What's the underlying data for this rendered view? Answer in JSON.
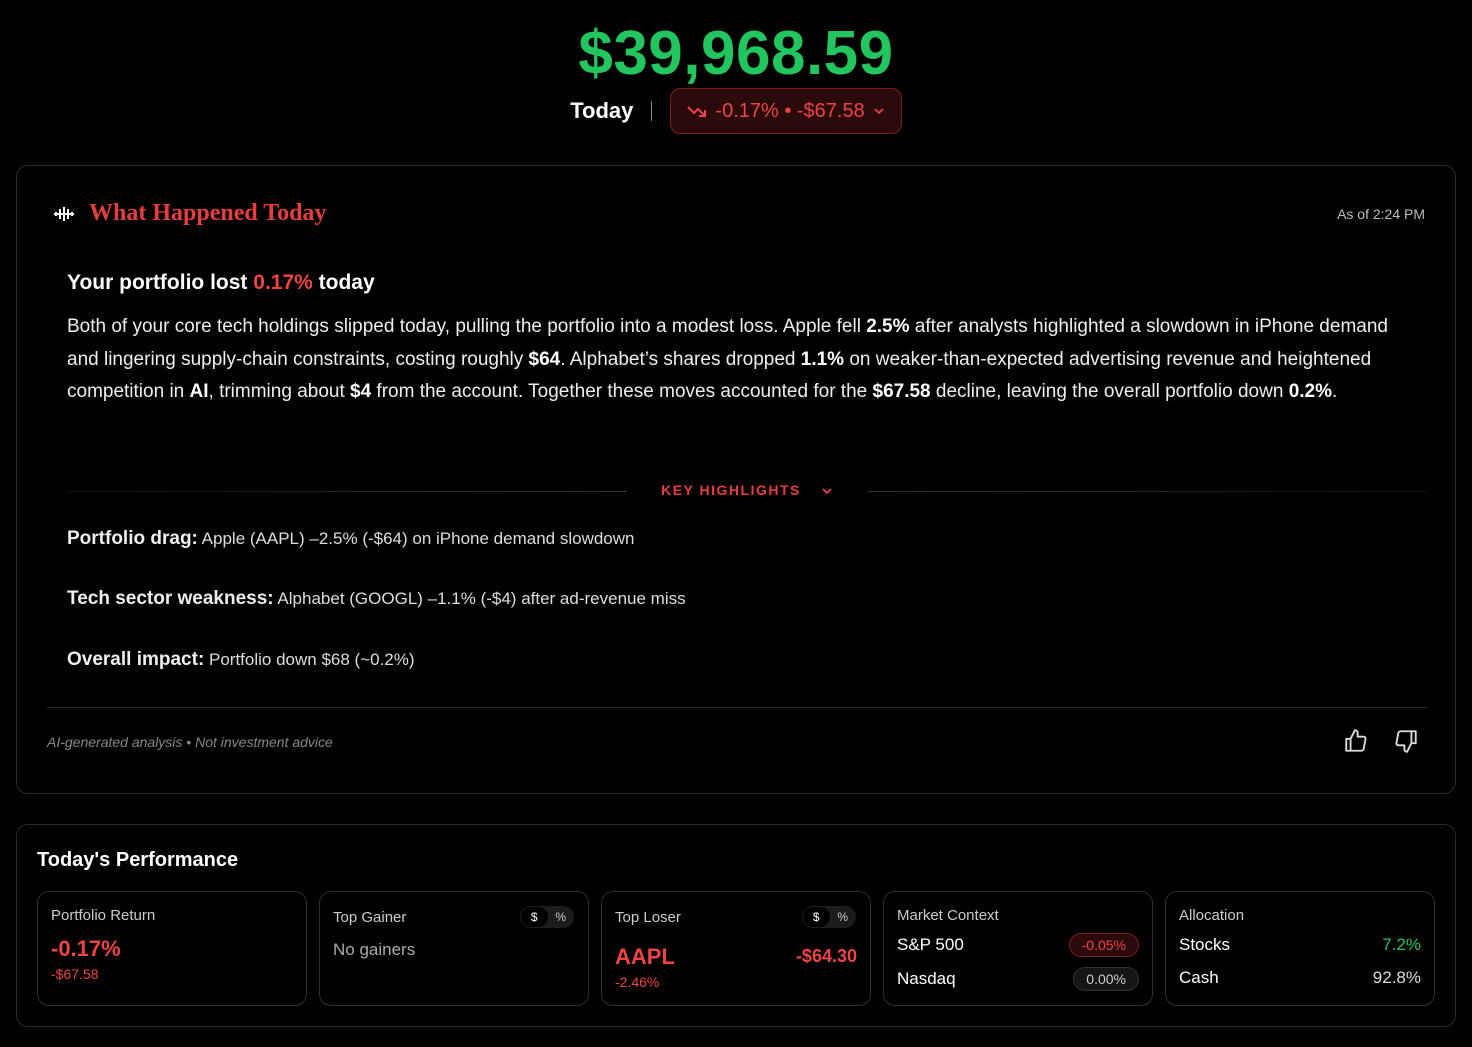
{
  "header": {
    "total_value": "$39,968.59",
    "period_label": "Today",
    "change_text": "-0.17% • -$67.58"
  },
  "colors": {
    "positive": "#22c55e",
    "negative": "#ef4444",
    "title_accent": "#e53e3e"
  },
  "summary_card": {
    "title": "What Happened Today",
    "as_of": "As of 2:24 PM",
    "headline_prefix": "Your portfolio lost ",
    "headline_pct": "0.17%",
    "headline_suffix": " today",
    "paragraph": [
      {
        "t": "Both of your core tech holdings slipped today, pulling the portfolio into a modest loss. Apple fell ",
        "b": false
      },
      {
        "t": "2.5%",
        "b": true
      },
      {
        "t": " after analysts highlighted a slowdown in iPhone demand and lingering supply-chain constraints, costing roughly ",
        "b": false
      },
      {
        "t": "$64",
        "b": true
      },
      {
        "t": ". Alphabet’s shares dropped ",
        "b": false
      },
      {
        "t": "1.1%",
        "b": true
      },
      {
        "t": " on weaker-than-expected advertising revenue and heightened competition in ",
        "b": false
      },
      {
        "t": "AI",
        "b": true
      },
      {
        "t": ", trimming about ",
        "b": false
      },
      {
        "t": "$4",
        "b": true
      },
      {
        "t": " from the account. Together these moves accounted for the ",
        "b": false
      },
      {
        "t": "$67.58",
        "b": true
      },
      {
        "t": " decline, leaving the overall portfolio down ",
        "b": false
      },
      {
        "t": "0.2%",
        "b": true
      },
      {
        "t": ".",
        "b": false
      }
    ],
    "key_highlights_label": "KEY HIGHLIGHTS",
    "highlights": [
      {
        "label": "Portfolio drag:",
        "text": " Apple (AAPL) –2.5% (-$64) on iPhone demand slowdown"
      },
      {
        "label": "Tech sector weakness:",
        "text": " Alphabet (GOOGL) –1.1% (-$4) after ad-revenue miss"
      },
      {
        "label": "Overall impact:",
        "text": " Portfolio down $68 (~0.2%)"
      }
    ],
    "disclaimer": "AI-generated analysis • Not investment advice"
  },
  "performance": {
    "title": "Today's Performance",
    "portfolio_return": {
      "label": "Portfolio Return",
      "pct": "-0.17%",
      "amount": "-$67.58"
    },
    "top_gainer": {
      "label": "Top Gainer",
      "toggle_dollar": "$",
      "toggle_pct": "%",
      "empty": "No gainers"
    },
    "top_loser": {
      "label": "Top Loser",
      "toggle_dollar": "$",
      "toggle_pct": "%",
      "ticker": "AAPL",
      "pct": "-2.46%",
      "amount": "-$64.30"
    },
    "market_context": {
      "label": "Market Context",
      "rows": [
        {
          "name": "S&P 500",
          "value": "-0.05%"
        },
        {
          "name": "Nasdaq",
          "value": "0.00%"
        }
      ]
    },
    "allocation": {
      "label": "Allocation",
      "rows": [
        {
          "name": "Stocks",
          "value": "7.2%"
        },
        {
          "name": "Cash",
          "value": "92.8%"
        }
      ]
    }
  }
}
